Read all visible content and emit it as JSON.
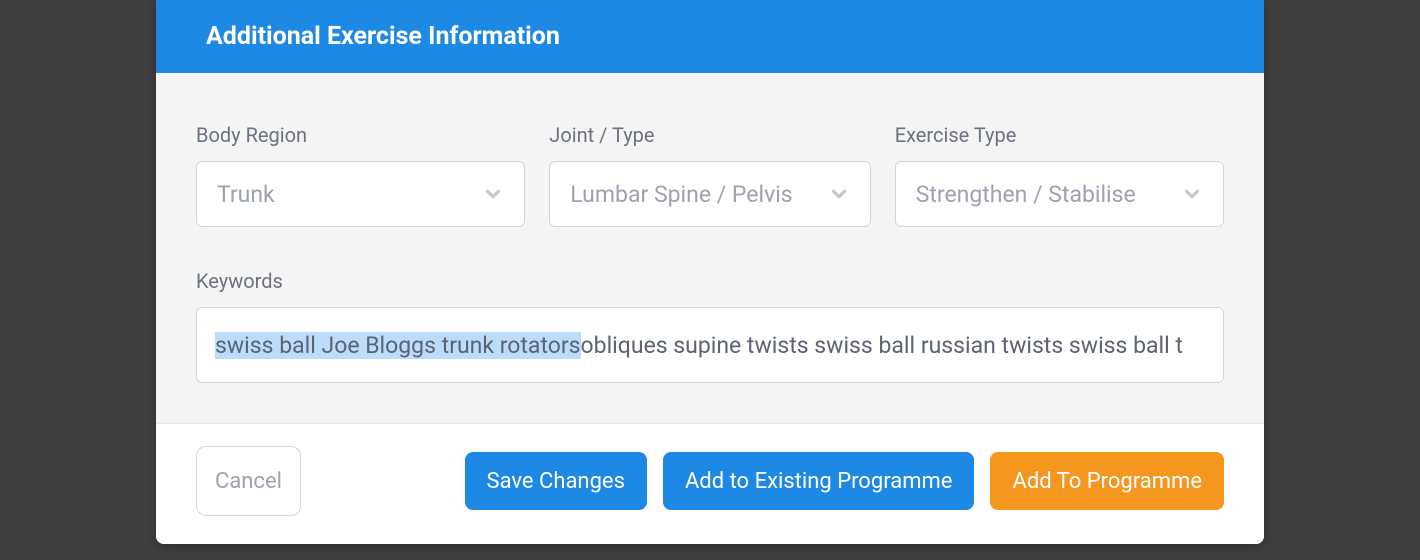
{
  "header": {
    "title": "Additional Exercise Information"
  },
  "form": {
    "bodyRegion": {
      "label": "Body Region",
      "value": "Trunk"
    },
    "jointType": {
      "label": "Joint / Type",
      "value": "Lumbar Spine / Pelvis"
    },
    "exerciseType": {
      "label": "Exercise Type",
      "value": "Strengthen / Stabilise"
    },
    "keywords": {
      "label": "Keywords",
      "highlighted": "swiss ball Joe Bloggs trunk rotators",
      "rest": " obliques supine twists swiss ball russian twists swiss ball t"
    }
  },
  "footer": {
    "cancel": "Cancel",
    "saveChanges": "Save Changes",
    "addExisting": "Add to Existing Programme",
    "addProgramme": "Add To Programme"
  }
}
